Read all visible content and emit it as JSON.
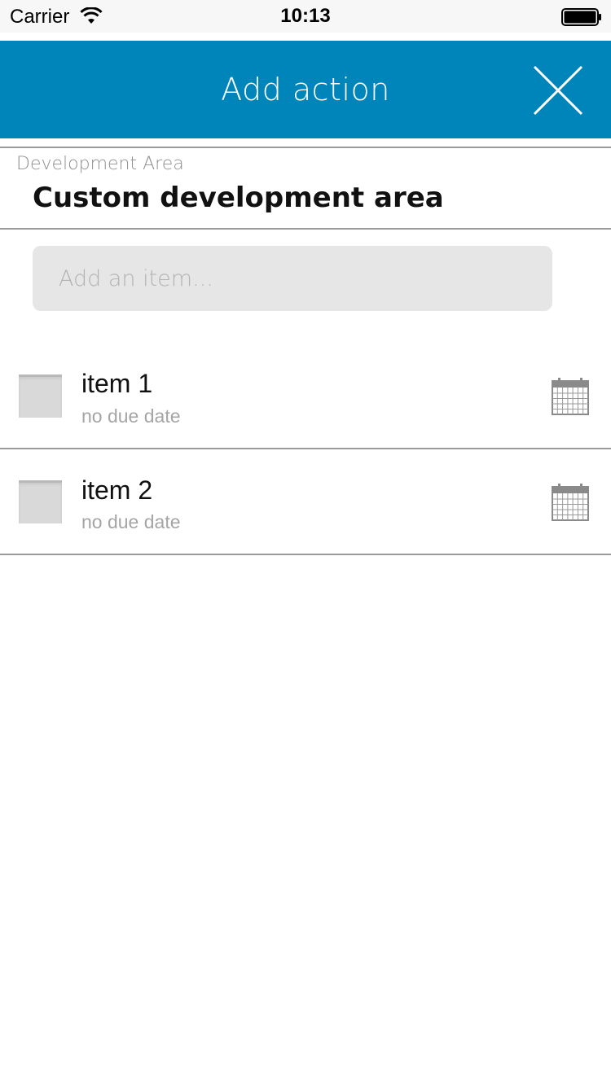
{
  "status_bar": {
    "carrier": "Carrier",
    "time": "10:13",
    "icons": [
      "wifi-icon",
      "battery-icon"
    ]
  },
  "nav": {
    "title": "Add action",
    "close_icon": "close-icon",
    "background_color": "#0085ba"
  },
  "development_area": {
    "label": "Development Area",
    "value": "Custom development area"
  },
  "add_item": {
    "placeholder": "Add an item..."
  },
  "items": [
    {
      "title": "item 1",
      "due": "no due date",
      "checked": false,
      "icon": "calendar-icon"
    },
    {
      "title": "item 2",
      "due": "no due date",
      "checked": false,
      "icon": "calendar-icon"
    }
  ]
}
